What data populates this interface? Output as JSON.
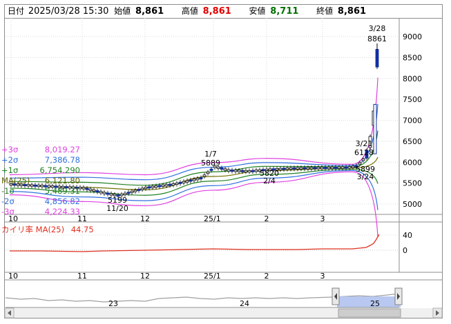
{
  "header": {
    "date_label": "日付",
    "datetime": "2025/03/28 15:30",
    "open_label": "始値",
    "open_value": "8,861",
    "high_label": "高値",
    "high_value": "8,861",
    "low_label": "安値",
    "low_value": "8,711",
    "close_label": "終値",
    "close_value": "8,861"
  },
  "colors": {
    "high": "#e00000",
    "low": "#007000",
    "sigma_plus3": "#e040e0",
    "sigma_plus2": "#3070e0",
    "sigma_plus1": "#208020",
    "ma25": "#707000",
    "sigma_minus1": "#208020",
    "sigma_minus2": "#3070e0",
    "sigma_minus3": "#e040e0",
    "indicator": "#e03020"
  },
  "legend": [
    {
      "label": "+3σ",
      "value": "8,019.27",
      "color": "#e040e0"
    },
    {
      "label": "+2σ",
      "value": "7,386.78",
      "color": "#3070e0"
    },
    {
      "label": "+1σ",
      "value": "6,754.290",
      "color": "#208020"
    },
    {
      "label": "MA(25)",
      "value": "6,121.80",
      "color": "#606000"
    },
    {
      "label": "-1σ",
      "value": "5,489.31",
      "color": "#208020"
    },
    {
      "label": "-2σ",
      "value": "4,856.82",
      "color": "#3070e0"
    },
    {
      "label": "-3σ",
      "value": "4,224.33",
      "color": "#e040e0"
    }
  ],
  "indicator": {
    "label": "カイリ率 MA(25)",
    "value": "44.75",
    "y_ticks": [
      "40",
      "0"
    ]
  },
  "price_axis": [
    "9000",
    "8500",
    "8000",
    "7500",
    "7000",
    "6500",
    "6000",
    "5500",
    "5000"
  ],
  "date_axis": [
    "10",
    "11",
    "12",
    "25/1",
    "2",
    "3"
  ],
  "annotations": [
    {
      "date": "3/28",
      "price": "8861"
    },
    {
      "date": "1/7",
      "price": "5889"
    },
    {
      "date": "3/21",
      "price": "6128"
    },
    {
      "date": "2/4",
      "price": "5820"
    },
    {
      "date": "3/24",
      "price": "5899"
    },
    {
      "date": "11/20",
      "price": "5199"
    }
  ],
  "overview": {
    "year_labels": [
      "23",
      "24",
      "25"
    ]
  },
  "chart_data": {
    "type": "line",
    "x": [
      "10",
      "11",
      "12",
      "25/1",
      "2",
      "3",
      "3/28"
    ],
    "ylim": [
      4800,
      9300
    ],
    "series": [
      {
        "name": "+3σ",
        "values": [
          5700,
          5750,
          5700,
          5990,
          6090,
          5950,
          8019
        ]
      },
      {
        "name": "+2σ",
        "values": [
          5620,
          5640,
          5580,
          5880,
          5990,
          5920,
          7387
        ]
      },
      {
        "name": "+1σ",
        "values": [
          5540,
          5520,
          5450,
          5770,
          5900,
          5890,
          6754
        ]
      },
      {
        "name": "MA(25)",
        "values": [
          5460,
          5400,
          5340,
          5660,
          5800,
          5860,
          6122
        ]
      },
      {
        "name": "-1σ",
        "values": [
          5380,
          5290,
          5210,
          5550,
          5710,
          5830,
          5489
        ]
      },
      {
        "name": "-2σ",
        "values": [
          5300,
          5170,
          5080,
          5440,
          5620,
          5800,
          4857
        ]
      },
      {
        "name": "-3σ",
        "values": [
          5220,
          5060,
          4960,
          5330,
          5520,
          5770,
          4224
        ]
      }
    ]
  }
}
